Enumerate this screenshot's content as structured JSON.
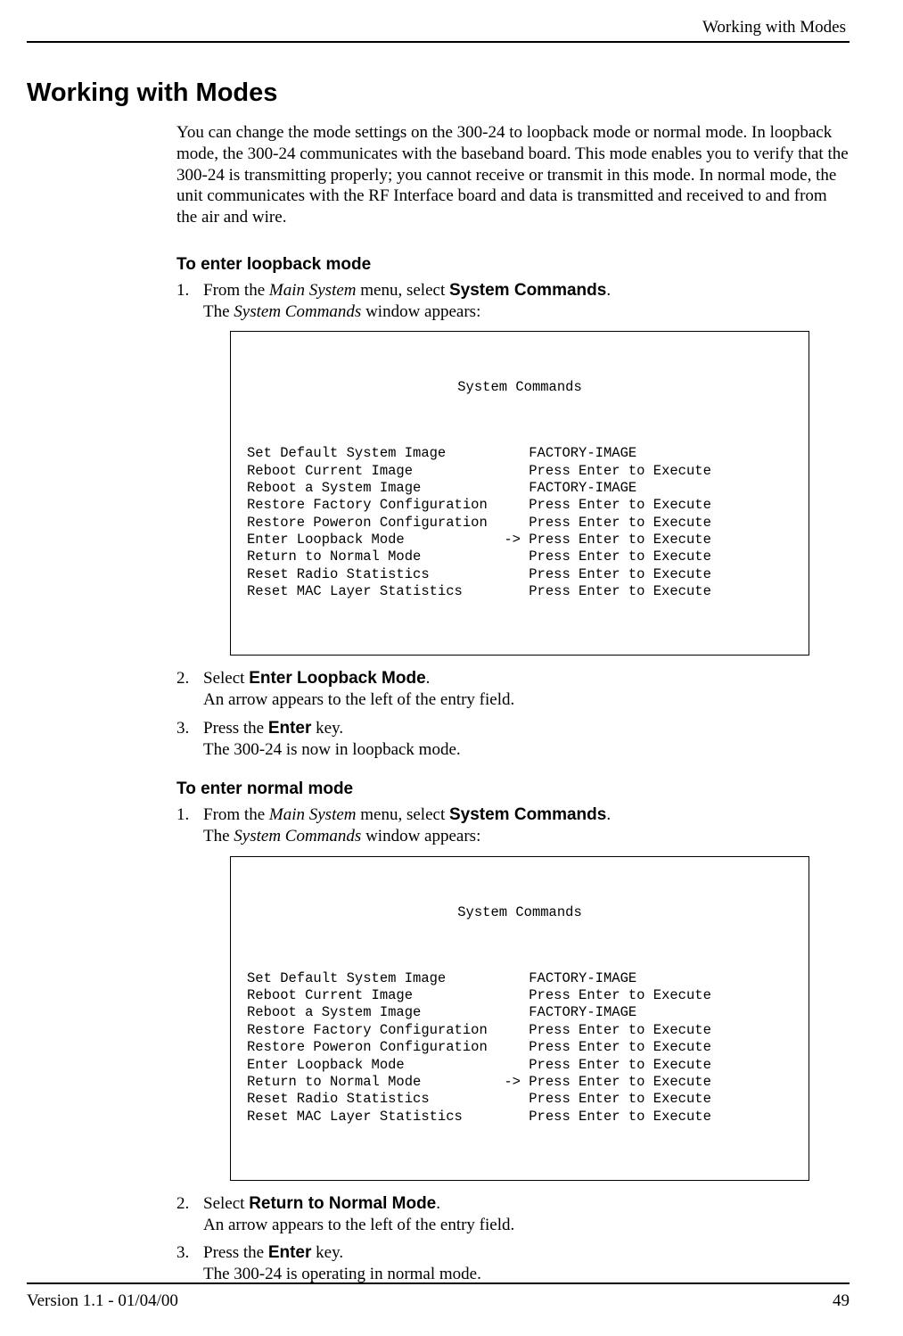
{
  "header_right": "Working with Modes",
  "section_title": "Working with Modes",
  "intro": "You can change the mode settings on the 300-24 to loopback mode or normal mode. In loopback mode, the 300-24 communicates with the baseband board. This mode enables you to verify that the 300-24 is transmitting properly; you cannot receive or transmit in this mode. In normal mode, the unit communicates with the RF Interface board and data is transmitted and received to and from the air and wire.",
  "loopback": {
    "subhead": "To enter loopback mode",
    "steps": [
      {
        "num": "1.",
        "pre": "From the ",
        "ital1": "Main System",
        "mid1": " menu, select ",
        "bold": "System Commands",
        "post": ".",
        "line2a": "The ",
        "line2b": "System Commands",
        "line2c": " window appears:"
      },
      {
        "num": "2.",
        "pre": "Select ",
        "bold": "Enter Loopback Mode",
        "post": ".",
        "line2": "An arrow appears to the left of the entry field."
      },
      {
        "num": "3.",
        "pre": "Press the ",
        "bold": "Enter",
        "post": " key.",
        "line2": "The 300-24 is now in loopback mode."
      }
    ],
    "terminal": {
      "title": "System Commands",
      "rows": [
        {
          "label": "Set Default System Image",
          "arrow": "   ",
          "value": "FACTORY-IMAGE"
        },
        {
          "label": "Reboot Current Image",
          "arrow": "   ",
          "value": "Press Enter to Execute"
        },
        {
          "label": "Reboot a System Image",
          "arrow": "   ",
          "value": "FACTORY-IMAGE"
        },
        {
          "label": "Restore Factory Configuration",
          "arrow": "   ",
          "value": "Press Enter to Execute"
        },
        {
          "label": "Restore Poweron Configuration",
          "arrow": "   ",
          "value": "Press Enter to Execute"
        },
        {
          "label": "Enter Loopback Mode",
          "arrow": "-> ",
          "value": "Press Enter to Execute"
        },
        {
          "label": "Return to Normal Mode",
          "arrow": "   ",
          "value": "Press Enter to Execute"
        },
        {
          "label": "Reset Radio Statistics",
          "arrow": "   ",
          "value": "Press Enter to Execute"
        },
        {
          "label": "Reset MAC Layer Statistics",
          "arrow": "   ",
          "value": "Press Enter to Execute"
        }
      ]
    }
  },
  "normal": {
    "subhead": "To enter normal mode",
    "steps": [
      {
        "num": "1.",
        "pre": "From the ",
        "ital1": "Main System",
        "mid1": " menu, select ",
        "bold": "System Commands",
        "post": ".",
        "line2a": "The ",
        "line2b": "System Commands",
        "line2c": " window appears:"
      },
      {
        "num": "2.",
        "pre": "Select ",
        "bold": "Return to Normal Mode",
        "post": ".",
        "line2": "An arrow appears to the left of the entry field."
      },
      {
        "num": "3.",
        "pre": "Press the ",
        "bold": "Enter",
        "post": " key.",
        "line2": "The 300-24 is operating in normal mode."
      }
    ],
    "terminal": {
      "title": "System Commands",
      "rows": [
        {
          "label": "Set Default System Image",
          "arrow": "   ",
          "value": "FACTORY-IMAGE"
        },
        {
          "label": "Reboot Current Image",
          "arrow": "   ",
          "value": "Press Enter to Execute"
        },
        {
          "label": "Reboot a System Image",
          "arrow": "   ",
          "value": "FACTORY-IMAGE"
        },
        {
          "label": "Restore Factory Configuration",
          "arrow": "   ",
          "value": "Press Enter to Execute"
        },
        {
          "label": "Restore Poweron Configuration",
          "arrow": "   ",
          "value": "Press Enter to Execute"
        },
        {
          "label": "Enter Loopback Mode",
          "arrow": "   ",
          "value": "Press Enter to Execute"
        },
        {
          "label": "Return to Normal Mode",
          "arrow": "-> ",
          "value": "Press Enter to Execute"
        },
        {
          "label": "Reset Radio Statistics",
          "arrow": "   ",
          "value": "Press Enter to Execute"
        },
        {
          "label": "Reset MAC Layer Statistics",
          "arrow": "   ",
          "value": "Press Enter to Execute"
        }
      ]
    }
  },
  "footer": {
    "version": "Version 1.1 - 01/04/00",
    "page": "49"
  }
}
